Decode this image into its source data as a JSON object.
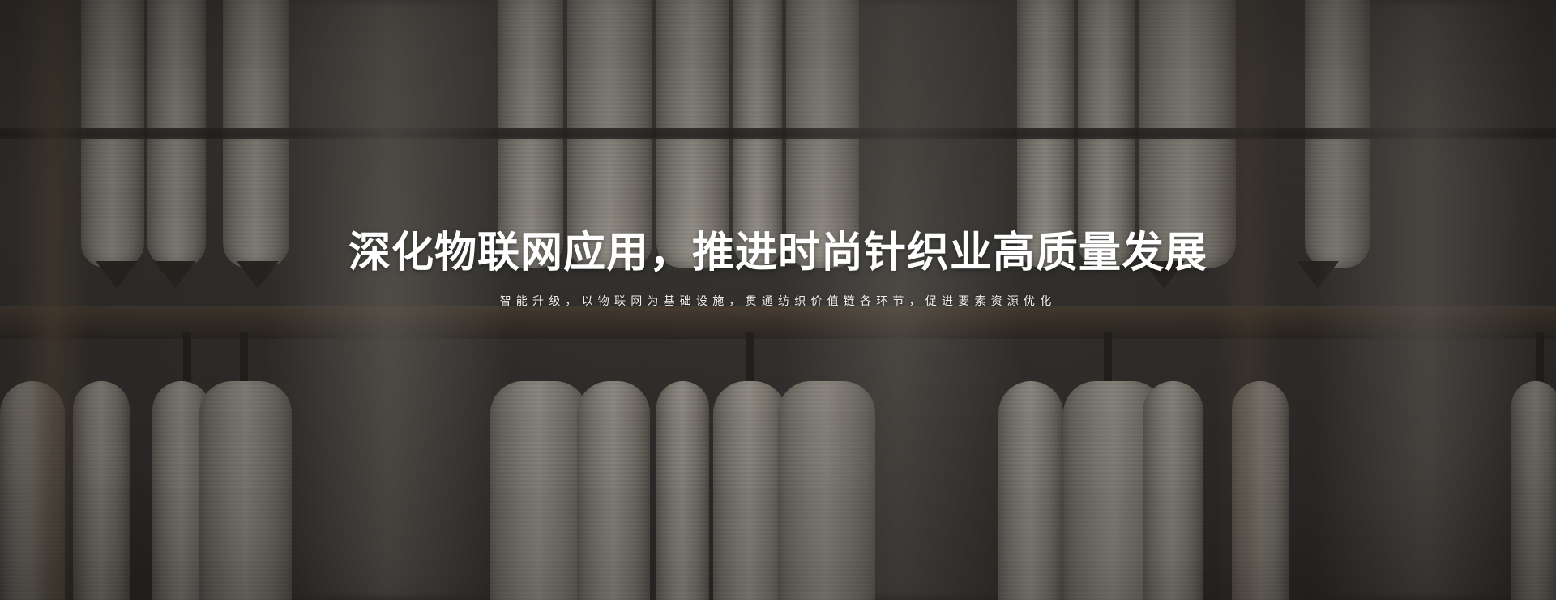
{
  "hero": {
    "title": "深化物联网应用，推进时尚针织业高质量发展",
    "subtitle": "智能升级，以物联网为基础设施，贯通纺织价值链各环节，促进要素资源优化",
    "background_image": "textile-yarn-spools-photo"
  },
  "colors": {
    "title_text": "#ffffff",
    "subtitle_text": "#f2f0ec",
    "overlay": "#2e2c29"
  }
}
